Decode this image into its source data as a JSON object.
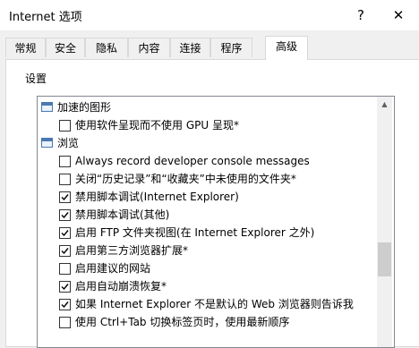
{
  "window": {
    "title": "Internet 选项",
    "help": "?",
    "close": "✕"
  },
  "tabs": [
    {
      "label": "常规",
      "active": false
    },
    {
      "label": "安全",
      "active": false
    },
    {
      "label": "隐私",
      "active": false
    },
    {
      "label": "内容",
      "active": false
    },
    {
      "label": "连接",
      "active": false
    },
    {
      "label": "程序",
      "active": false
    },
    {
      "label": "高级",
      "active": true
    }
  ],
  "settings": {
    "group_label": "设置",
    "categories": [
      {
        "label": "加速的图形",
        "icon": "category-icon",
        "options": [
          {
            "label": "使用软件呈现而不使用 GPU 呈现*",
            "checked": false
          }
        ]
      },
      {
        "label": "浏览",
        "icon": "category-icon",
        "options": [
          {
            "label": "Always record developer console messages",
            "checked": false
          },
          {
            "label": "关闭“历史记录”和“收藏夹”中未使用的文件夹*",
            "checked": false
          },
          {
            "label": "禁用脚本调试(Internet Explorer)",
            "checked": true
          },
          {
            "label": "禁用脚本调试(其他)",
            "checked": true
          },
          {
            "label": "启用 FTP 文件夹视图(在 Internet Explorer 之外)",
            "checked": true
          },
          {
            "label": "启用第三方浏览器扩展*",
            "checked": true
          },
          {
            "label": "启用建议的网站",
            "checked": false
          },
          {
            "label": "启用自动崩溃恢复*",
            "checked": true
          },
          {
            "label": "如果 Internet Explorer 不是默认的 Web 浏览器则告诉我",
            "checked": true
          },
          {
            "label": "使用 Ctrl+Tab 切换标签页时，使用最新顺序",
            "checked": false
          }
        ]
      }
    ],
    "scroll_fraction": 0.65
  }
}
